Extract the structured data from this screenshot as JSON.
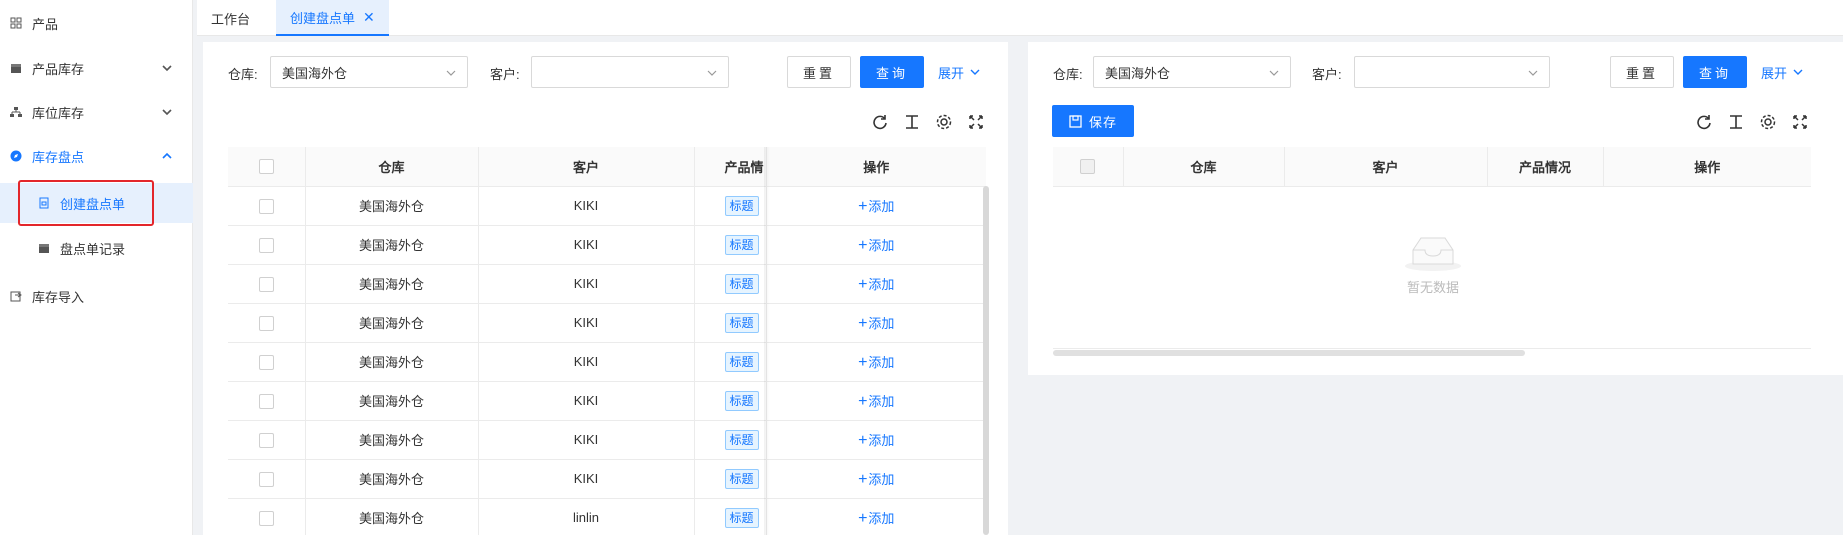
{
  "sidebar": {
    "items": [
      {
        "label": "产品",
        "icon": "grid-icon"
      },
      {
        "label": "产品库存",
        "icon": "box-icon"
      },
      {
        "label": "库位库存",
        "icon": "sitemap-icon"
      },
      {
        "label": "库存盘点",
        "icon": "compass-icon"
      },
      {
        "label": "创建盘点单",
        "icon": "document-icon"
      },
      {
        "label": "盘点单记录",
        "icon": "record-icon"
      },
      {
        "label": "库存导入",
        "icon": "import-icon"
      }
    ]
  },
  "tabs": [
    {
      "label": "工作台"
    },
    {
      "label": "创建盘点单",
      "close": "✕"
    }
  ],
  "left_panel": {
    "warehouse_label": "仓库:",
    "warehouse_value": "美国海外仓",
    "customer_label": "客户:",
    "customer_value": "",
    "reset_label": "重置",
    "query_label": "查询",
    "expand_label": "展开",
    "columns": [
      "仓库",
      "客户",
      "产品情",
      "操作"
    ],
    "rows": [
      {
        "warehouse": "美国海外仓",
        "customer": "KIKI",
        "tag": "标题",
        "action": "添加"
      },
      {
        "warehouse": "美国海外仓",
        "customer": "KIKI",
        "tag": "标题",
        "action": "添加"
      },
      {
        "warehouse": "美国海外仓",
        "customer": "KIKI",
        "tag": "标题",
        "action": "添加"
      },
      {
        "warehouse": "美国海外仓",
        "customer": "KIKI",
        "tag": "标题",
        "action": "添加"
      },
      {
        "warehouse": "美国海外仓",
        "customer": "KIKI",
        "tag": "标题",
        "action": "添加"
      },
      {
        "warehouse": "美国海外仓",
        "customer": "KIKI",
        "tag": "标题",
        "action": "添加"
      },
      {
        "warehouse": "美国海外仓",
        "customer": "KIKI",
        "tag": "标题",
        "action": "添加"
      },
      {
        "warehouse": "美国海外仓",
        "customer": "KIKI",
        "tag": "标题",
        "action": "添加"
      },
      {
        "warehouse": "美国海外仓",
        "customer": "linlin",
        "tag": "标题",
        "action": "添加"
      }
    ]
  },
  "right_panel": {
    "warehouse_label": "仓库:",
    "warehouse_value": "美国海外仓",
    "customer_label": "客户:",
    "customer_value": "",
    "reset_label": "重置",
    "query_label": "查询",
    "expand_label": "展开",
    "save_label": "保存",
    "columns": [
      "仓库",
      "客户",
      "产品情况",
      "操作"
    ],
    "empty_text": "暂无数据"
  },
  "colors": {
    "primary": "#1677ff",
    "highlight_box": "#e3262b"
  }
}
